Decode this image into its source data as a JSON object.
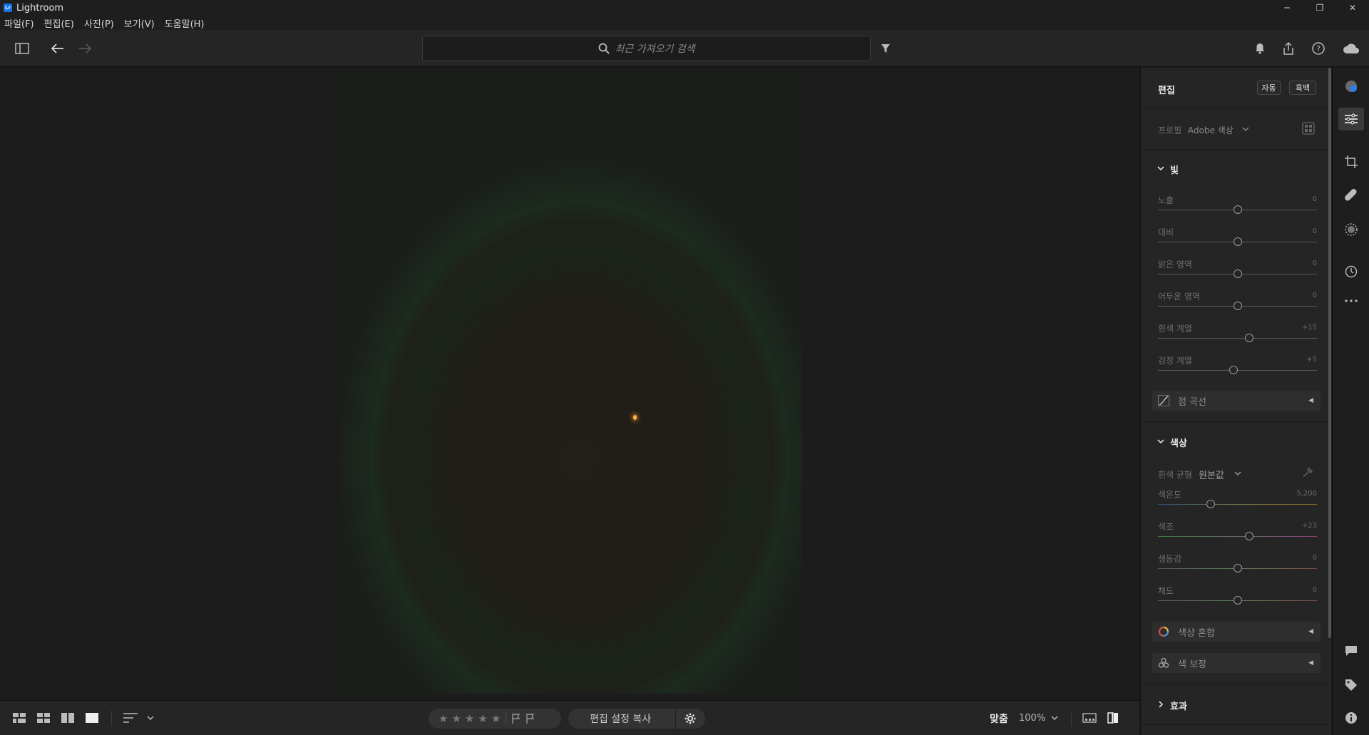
{
  "app": {
    "logo": "Lr",
    "title": "Lightroom"
  },
  "window_controls": {
    "minimize": "─",
    "restore": "❐",
    "close": "✕"
  },
  "menu": [
    "파일(F)",
    "편집(E)",
    "사진(P)",
    "보기(V)",
    "도움말(H)"
  ],
  "toolbar": {
    "search_placeholder": "최근 가져오기 검색",
    "icons": [
      "panel-toggle-icon",
      "back-arrow-icon",
      "forward-arrow-icon",
      "filter-icon",
      "bell-icon",
      "share-icon",
      "help-icon",
      "cloud-icon"
    ]
  },
  "edit_panel": {
    "title": "편집",
    "auto_label": "자동",
    "bw_label": "흑백",
    "profile_label": "프로필",
    "profile_value": "Adobe 색상",
    "light": {
      "title": "빛",
      "sliders": [
        {
          "label": "노출",
          "value": "0",
          "level": 0.5
        },
        {
          "label": "대비",
          "value": "0",
          "level": 0.5
        },
        {
          "label": "밝은 영역",
          "value": "0",
          "level": 0.5
        },
        {
          "label": "어두운 영역",
          "value": "0",
          "level": 0.5
        },
        {
          "label": "흰색 계열",
          "value": "+15",
          "level": 0.575
        },
        {
          "label": "검정 계열",
          "value": "+5",
          "level": 0.475
        }
      ],
      "point_curve": "점 곡선"
    },
    "color": {
      "title": "색상",
      "wb_label": "흰색 균형",
      "wb_value": "원본값",
      "sliders": [
        {
          "label": "색온도",
          "value": "5,200",
          "level": 0.33
        },
        {
          "label": "색조",
          "value": "+23",
          "level": 0.575
        },
        {
          "label": "생동감",
          "value": "0",
          "level": 0.5
        },
        {
          "label": "채도",
          "value": "0",
          "level": 0.5
        }
      ],
      "color_mix": "색상 혼합",
      "color_grading": "색 보정"
    },
    "effects": {
      "title": "효과"
    }
  },
  "bottombar": {
    "stars": [
      "★",
      "★",
      "★",
      "★",
      "★"
    ],
    "copy_settings": "편집 설정 복사",
    "fit": "맞춤",
    "zoom": "100%"
  },
  "colors": {
    "accent": "#1473e6",
    "background": "#1b1b1b",
    "panel": "#252525"
  }
}
